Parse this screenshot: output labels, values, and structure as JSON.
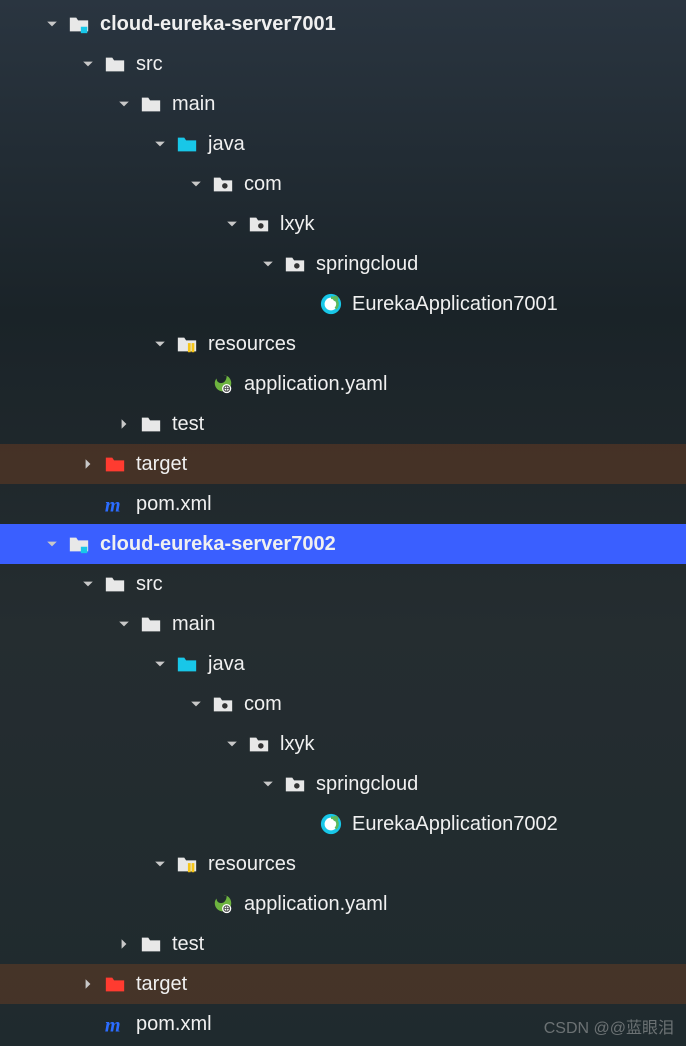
{
  "watermark": "CSDN @@蓝眼泪",
  "nodes": [
    {
      "id": "srv1",
      "label": "cloud-eureka-server7001",
      "indent": 0,
      "expanded": true,
      "icon": "module-folder",
      "bold": true
    },
    {
      "id": "srv1-src",
      "label": "src",
      "indent": 1,
      "expanded": true,
      "icon": "folder"
    },
    {
      "id": "srv1-main",
      "label": "main",
      "indent": 2,
      "expanded": true,
      "icon": "folder"
    },
    {
      "id": "srv1-java",
      "label": "java",
      "indent": 3,
      "expanded": true,
      "icon": "source-folder"
    },
    {
      "id": "srv1-com",
      "label": "com",
      "indent": 4,
      "expanded": true,
      "icon": "package-folder"
    },
    {
      "id": "srv1-lxyk",
      "label": "lxyk",
      "indent": 5,
      "expanded": true,
      "icon": "package-folder"
    },
    {
      "id": "srv1-springcloud",
      "label": "springcloud",
      "indent": 6,
      "expanded": true,
      "icon": "package-folder"
    },
    {
      "id": "srv1-app",
      "label": "EurekaApplication7001",
      "indent": 7,
      "leaf": true,
      "icon": "spring-class"
    },
    {
      "id": "srv1-resources",
      "label": "resources",
      "indent": 3,
      "expanded": true,
      "icon": "resources-folder"
    },
    {
      "id": "srv1-yaml",
      "label": "application.yaml",
      "indent": 4,
      "leaf": true,
      "icon": "spring-file"
    },
    {
      "id": "srv1-test",
      "label": "test",
      "indent": 2,
      "expanded": false,
      "icon": "folder"
    },
    {
      "id": "srv1-target",
      "label": "target",
      "indent": 1,
      "expanded": false,
      "icon": "target-folder",
      "highlight": true
    },
    {
      "id": "srv1-pom",
      "label": "pom.xml",
      "indent": 1,
      "leaf": true,
      "icon": "maven-file"
    },
    {
      "id": "srv2",
      "label": "cloud-eureka-server7002",
      "indent": 0,
      "expanded": true,
      "icon": "module-folder",
      "bold": true,
      "selected": true
    },
    {
      "id": "srv2-src",
      "label": "src",
      "indent": 1,
      "expanded": true,
      "icon": "folder"
    },
    {
      "id": "srv2-main",
      "label": "main",
      "indent": 2,
      "expanded": true,
      "icon": "folder"
    },
    {
      "id": "srv2-java",
      "label": "java",
      "indent": 3,
      "expanded": true,
      "icon": "source-folder"
    },
    {
      "id": "srv2-com",
      "label": "com",
      "indent": 4,
      "expanded": true,
      "icon": "package-folder"
    },
    {
      "id": "srv2-lxyk",
      "label": "lxyk",
      "indent": 5,
      "expanded": true,
      "icon": "package-folder"
    },
    {
      "id": "srv2-springcloud",
      "label": "springcloud",
      "indent": 6,
      "expanded": true,
      "icon": "package-folder"
    },
    {
      "id": "srv2-app",
      "label": "EurekaApplication7002",
      "indent": 7,
      "leaf": true,
      "icon": "spring-class"
    },
    {
      "id": "srv2-resources",
      "label": "resources",
      "indent": 3,
      "expanded": true,
      "icon": "resources-folder"
    },
    {
      "id": "srv2-yaml",
      "label": "application.yaml",
      "indent": 4,
      "leaf": true,
      "icon": "spring-file"
    },
    {
      "id": "srv2-test",
      "label": "test",
      "indent": 2,
      "expanded": false,
      "icon": "folder"
    },
    {
      "id": "srv2-target",
      "label": "target",
      "indent": 1,
      "expanded": false,
      "icon": "target-folder",
      "highlight": true
    },
    {
      "id": "srv2-pom",
      "label": "pom.xml",
      "indent": 1,
      "leaf": true,
      "icon": "maven-file"
    }
  ]
}
